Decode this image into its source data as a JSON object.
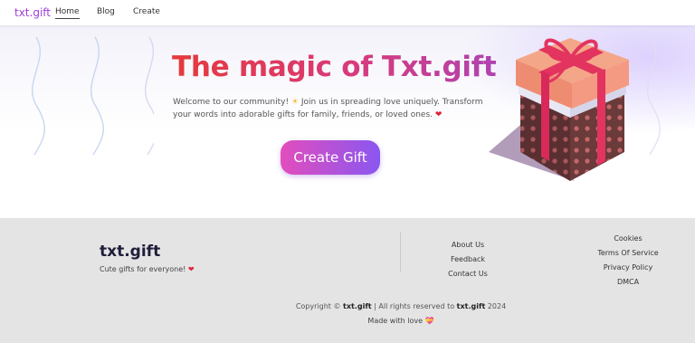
{
  "nav": {
    "logo": "txt.gift",
    "links": [
      {
        "label": "Home"
      },
      {
        "label": "Blog"
      },
      {
        "label": "Create"
      }
    ]
  },
  "hero": {
    "title": "The magic of Txt.gift",
    "desc_part1": "Welcome to our community! ",
    "sparkle": "☀",
    "desc_part2": " Join us in spreading love uniquely. Transform your words into adorable gifts for family, friends, or loved ones. ",
    "heart": "❤",
    "cta_label": "Create Gift"
  },
  "footer": {
    "logo": "txt.gift",
    "tagline": "Cute gifts for everyone! ",
    "tagline_heart": "❤",
    "links_col1": [
      "About Us",
      "Feedback",
      "Contact Us"
    ],
    "links_col2": [
      "Cookies",
      "Terms Of Service",
      "Privacy Policy",
      "DMCA"
    ],
    "copyright_prefix": "Copyright © ",
    "copyright_brand": "txt.gift",
    "copyright_mid": " | All rights reserved to ",
    "copyright_brand2": "txt.gift",
    "copyright_year": " 2024",
    "made_with": "Made with love ",
    "made_with_icon": "💝"
  },
  "colors": {
    "brand_purple": "#9c3fd8",
    "title_red": "#e63a3a",
    "cta_start": "#e24dbd",
    "cta_end": "#8a57f0",
    "footer_bg": "#e4e4e4"
  },
  "icons": {
    "gift": "gift-box-icon"
  }
}
